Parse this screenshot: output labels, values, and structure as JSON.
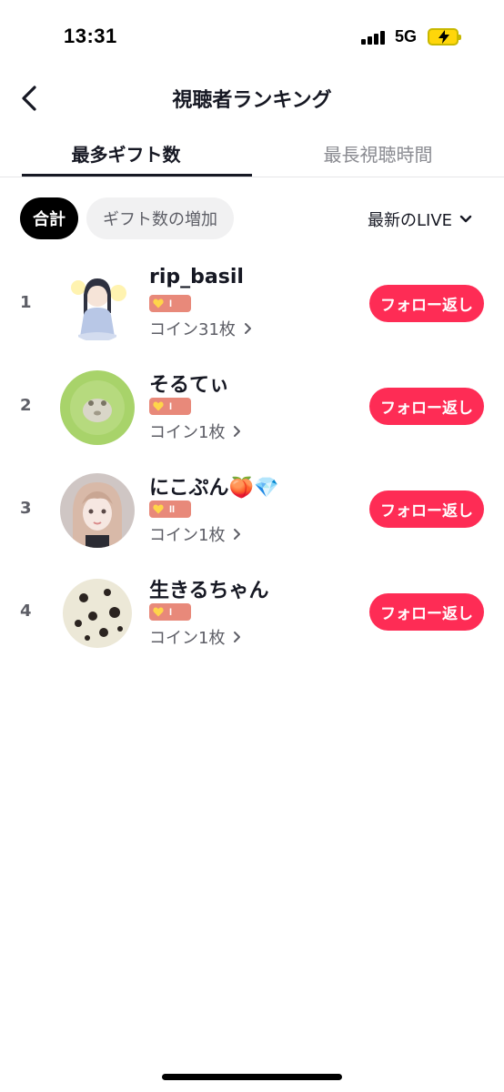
{
  "status_bar": {
    "time": "13:31",
    "network": "5G"
  },
  "header": {
    "title": "視聴者ランキング",
    "back_icon": "chevron-left-icon"
  },
  "tabs": [
    {
      "label": "最多ギフト数",
      "active": true
    },
    {
      "label": "最長視聴時間",
      "active": false
    }
  ],
  "filters": {
    "chips": [
      {
        "label": "合計",
        "selected": true
      },
      {
        "label": "ギフト数の増加",
        "selected": false
      }
    ],
    "sort_label": "最新のLIVE"
  },
  "ranking": [
    {
      "rank": "1",
      "name": "rip_basil",
      "level": "I",
      "coins": "コイン31枚",
      "follow_label": "フォロー返し"
    },
    {
      "rank": "2",
      "name": "そるてぃ",
      "level": "I",
      "coins": "コイン1枚",
      "follow_label": "フォロー返し"
    },
    {
      "rank": "3",
      "name": "にこぷん🍑💎",
      "level": "II",
      "coins": "コイン1枚",
      "follow_label": "フォロー返し"
    },
    {
      "rank": "4",
      "name": "生きるちゃん",
      "level": "I",
      "coins": "コイン1枚",
      "follow_label": "フォロー返し"
    }
  ],
  "colors": {
    "accent": "#fe2c55",
    "badge": "#e8897a",
    "text": "#161823",
    "muted": "#8a8b91"
  }
}
